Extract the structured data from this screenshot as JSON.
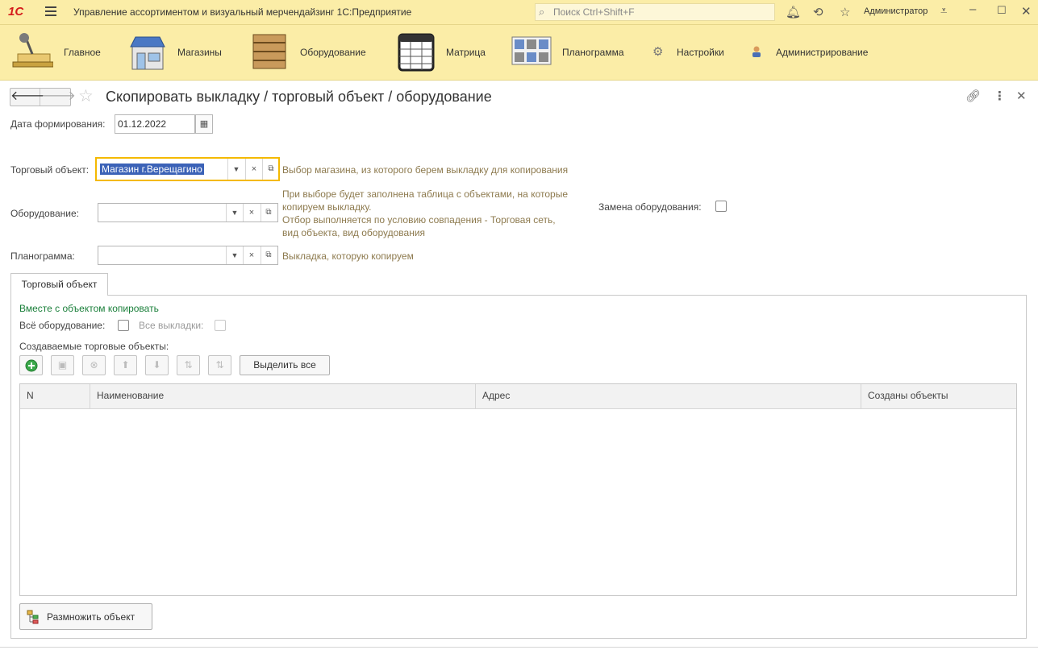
{
  "app": {
    "logo": "1С",
    "title": "Управление ассортиментом  и визуальный мерчендайзинг 1С:Предприятие",
    "search_placeholder": "Поиск Ctrl+Shift+F",
    "user": "Администратор"
  },
  "sections": [
    {
      "label": "Главное",
      "icon": "desk-lamp-icon"
    },
    {
      "label": "Магазины",
      "icon": "store-icon"
    },
    {
      "label": "Оборудование",
      "icon": "shelving-icon"
    },
    {
      "label": "Матрица",
      "icon": "matrix-table-icon"
    },
    {
      "label": "Планограмма",
      "icon": "planogram-icon"
    },
    {
      "label": "Настройки",
      "icon": "gear-icon"
    },
    {
      "label": "Администрирование",
      "icon": "admin-user-icon"
    }
  ],
  "form": {
    "title": "Скопировать выкладку / торговый объект / оборудование",
    "date_label": "Дата формирования:",
    "date_value": "01.12.2022",
    "trade_object_label": "Торговый объект:",
    "trade_object_value": "Магазин г.Верещагино",
    "trade_object_hint": "Выбор магазина, из которого берем выкладку для копирования",
    "equipment_label": "Оборудование:",
    "equipment_value": "",
    "equipment_hint_lines": [
      "При выборе будет заполнена таблица с объектами, на которые",
      "копируем выкладку.",
      "Отбор выполняется по условию совпадения - Торговая сеть,",
      "вид объекта, вид оборудования"
    ],
    "replace_equipment_label": "Замена оборудования:",
    "planogram_label": "Планограмма:",
    "planogram_value": "",
    "planogram_hint": "Выкладка, которую копируем"
  },
  "tab": {
    "label": "Торговый объект",
    "group_title": "Вместе с объектом копировать",
    "all_equipment_label": "Всё оборудование:",
    "all_layouts_label": "Все выкладки:",
    "created_objects_label": "Создаваемые торговые объекты:",
    "select_all_label": "Выделить все",
    "table_columns": [
      "N",
      "Наименование",
      "Адрес",
      "Созданы объекты"
    ],
    "multiply_label": "Размножить объект"
  },
  "colors": {
    "header_bg": "#fbeda7",
    "hint_text": "#8d7a4e",
    "group_title": "#1a7f3a",
    "focus_border": "#f4b900",
    "selection": "#3b62b7"
  }
}
